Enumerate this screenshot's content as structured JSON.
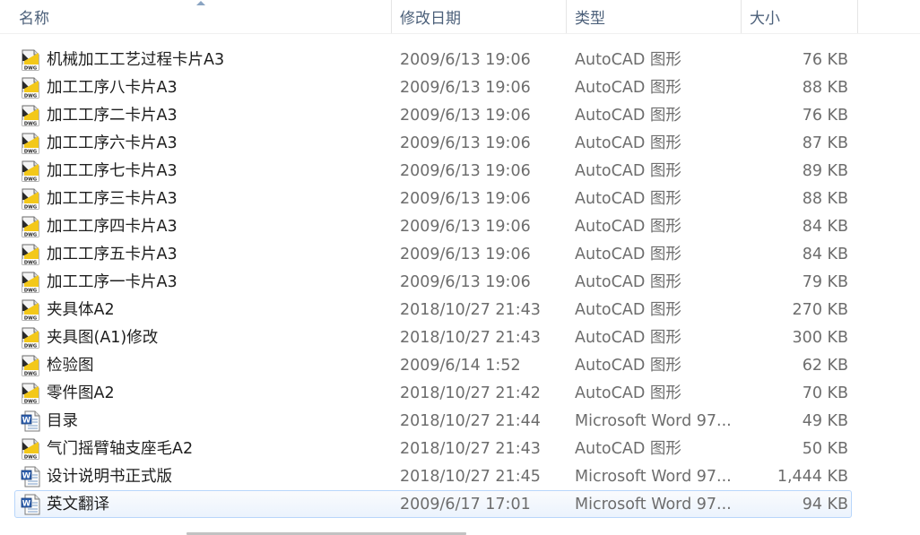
{
  "columns": {
    "name": "名称",
    "date": "修改日期",
    "type": "类型",
    "size": "大小"
  },
  "files": [
    {
      "name": "机械加工工艺过程卡片A3",
      "date": "2009/6/13 19:06",
      "type": "AutoCAD 图形",
      "size": "76 KB",
      "icon": "dwg-file-icon"
    },
    {
      "name": "加工工序八卡片A3",
      "date": "2009/6/13 19:06",
      "type": "AutoCAD 图形",
      "size": "88 KB",
      "icon": "dwg-file-icon"
    },
    {
      "name": "加工工序二卡片A3",
      "date": "2009/6/13 19:06",
      "type": "AutoCAD 图形",
      "size": "76 KB",
      "icon": "dwg-file-icon"
    },
    {
      "name": "加工工序六卡片A3",
      "date": "2009/6/13 19:06",
      "type": "AutoCAD 图形",
      "size": "87 KB",
      "icon": "dwg-file-icon"
    },
    {
      "name": "加工工序七卡片A3",
      "date": "2009/6/13 19:06",
      "type": "AutoCAD 图形",
      "size": "89 KB",
      "icon": "dwg-file-icon"
    },
    {
      "name": "加工工序三卡片A3",
      "date": "2009/6/13 19:06",
      "type": "AutoCAD 图形",
      "size": "88 KB",
      "icon": "dwg-file-icon"
    },
    {
      "name": "加工工序四卡片A3",
      "date": "2009/6/13 19:06",
      "type": "AutoCAD 图形",
      "size": "84 KB",
      "icon": "dwg-file-icon"
    },
    {
      "name": "加工工序五卡片A3",
      "date": "2009/6/13 19:06",
      "type": "AutoCAD 图形",
      "size": "84 KB",
      "icon": "dwg-file-icon"
    },
    {
      "name": "加工工序一卡片A3",
      "date": "2009/6/13 19:06",
      "type": "AutoCAD 图形",
      "size": "79 KB",
      "icon": "dwg-file-icon"
    },
    {
      "name": "夹具体A2",
      "date": "2018/10/27 21:43",
      "type": "AutoCAD 图形",
      "size": "270 KB",
      "icon": "dwg-file-icon"
    },
    {
      "name": "夹具图(A1)修改",
      "date": "2018/10/27 21:43",
      "type": "AutoCAD 图形",
      "size": "300 KB",
      "icon": "dwg-file-icon"
    },
    {
      "name": "检验图",
      "date": "2009/6/14 1:52",
      "type": "AutoCAD 图形",
      "size": "62 KB",
      "icon": "dwg-file-icon"
    },
    {
      "name": "零件图A2",
      "date": "2018/10/27 21:42",
      "type": "AutoCAD 图形",
      "size": "70 KB",
      "icon": "dwg-file-icon"
    },
    {
      "name": "目录",
      "date": "2018/10/27 21:44",
      "type": "Microsoft Word 97...",
      "size": "49 KB",
      "icon": "word-doc-icon"
    },
    {
      "name": "气门摇臂轴支座毛A2",
      "date": "2018/10/27 21:43",
      "type": "AutoCAD 图形",
      "size": "50 KB",
      "icon": "dwg-file-icon"
    },
    {
      "name": "设计说明书正式版",
      "date": "2018/10/27 21:45",
      "type": "Microsoft Word 97...",
      "size": "1,444 KB",
      "icon": "word-doc-icon"
    },
    {
      "name": "英文翻译",
      "date": "2009/6/17 17:01",
      "type": "Microsoft Word 97...",
      "size": "94 KB",
      "icon": "word-doc-icon",
      "hover": true
    }
  ],
  "icons": {
    "dwg_label": "DWG",
    "word_label": "W"
  },
  "colors": {
    "header_text": "#4c607a",
    "detail_text": "#6d6d6d",
    "hover_border": "#b8d6fb"
  }
}
